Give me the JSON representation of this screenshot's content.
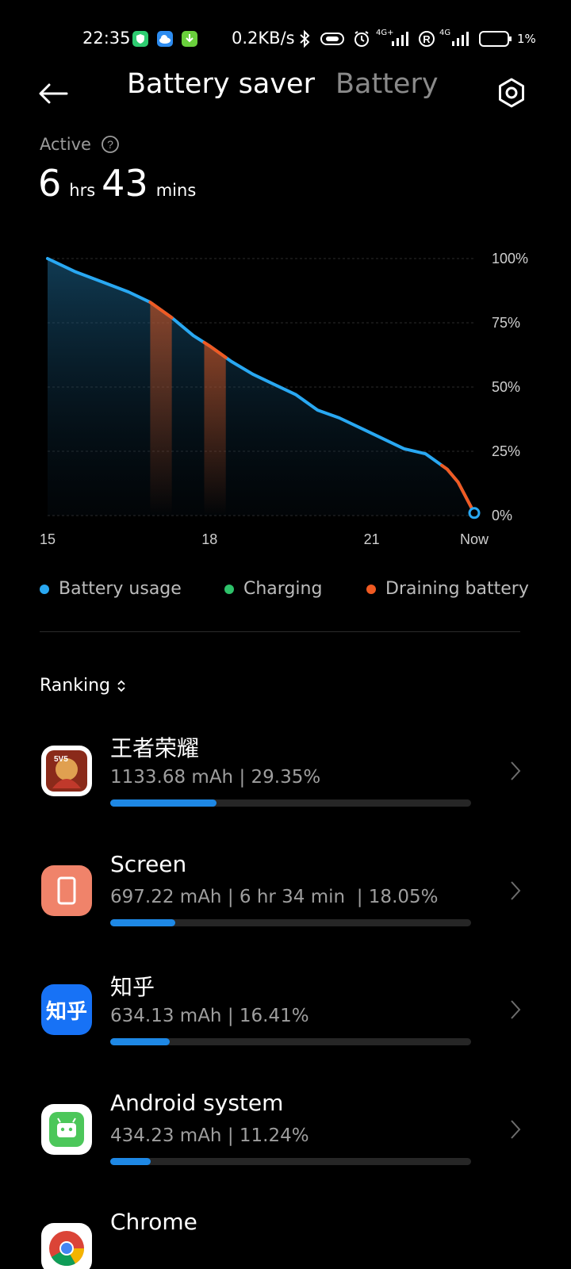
{
  "status_bar": {
    "time": "22:35",
    "net_speed": "0.2KB/s",
    "net_label_1": "4G+",
    "net_label_2": "4G",
    "battery_percent": "1%"
  },
  "header": {
    "back_icon": "back-arrow-icon",
    "tabs": [
      {
        "label": "Battery saver",
        "active": true
      },
      {
        "label": "Battery",
        "active": false
      }
    ],
    "settings_icon": "hexagon-settings-icon"
  },
  "summary": {
    "label": "Active",
    "hours": "6",
    "hours_unit": "hrs",
    "minutes": "43",
    "minutes_unit": "mins"
  },
  "chart_data": {
    "type": "line",
    "y_ticks": [
      "100%",
      "75%",
      "50%",
      "25%",
      "0%"
    ],
    "x_ticks": [
      "15",
      "18",
      "21",
      "Now"
    ],
    "ylim": [
      0,
      100
    ],
    "x": [
      15.0,
      15.5,
      16.0,
      16.5,
      16.9,
      17.3,
      17.7,
      18.0,
      18.4,
      18.8,
      19.2,
      19.6,
      20.0,
      20.4,
      20.8,
      21.2,
      21.6,
      22.0,
      22.4,
      22.6,
      22.9
    ],
    "series": [
      {
        "values": [
          100,
          95,
          91,
          87,
          83,
          77,
          70,
          66,
          60,
          55,
          51,
          47,
          41,
          38,
          34,
          30,
          26,
          24,
          18,
          13,
          1
        ]
      }
    ],
    "draining_intervals": [
      [
        16.9,
        17.3
      ],
      [
        17.9,
        18.3
      ],
      [
        22.3,
        22.9
      ]
    ],
    "grid": true,
    "colors": {
      "usage": "#29a8f2",
      "charging": "#2ec26a",
      "draining": "#f05a22"
    }
  },
  "legend": [
    {
      "label": "Battery usage",
      "color": "#29a8f2"
    },
    {
      "label": "Charging",
      "color": "#2ec26a"
    },
    {
      "label": "Draining battery",
      "color": "#f05a22"
    }
  ],
  "ranking": {
    "label": "Ranking",
    "items": [
      {
        "name": "王者荣耀",
        "detail": "1133.68 mAh | 29.35%",
        "percent": 29.35,
        "icon": "honor-of-kings-icon"
      },
      {
        "name": "Screen",
        "detail": "697.22 mAh | 6 hr 34 min  | 18.05%",
        "percent": 18.05,
        "icon": "screen-icon"
      },
      {
        "name": "知乎",
        "detail": "634.13 mAh | 16.41%",
        "percent": 16.41,
        "icon": "zhihu-icon",
        "icon_text": "知乎"
      },
      {
        "name": "Android system",
        "detail": "434.23 mAh | 11.24%",
        "percent": 11.24,
        "icon": "android-icon"
      },
      {
        "name": "Chrome",
        "detail": "",
        "percent": null,
        "icon": "chrome-icon"
      }
    ]
  }
}
